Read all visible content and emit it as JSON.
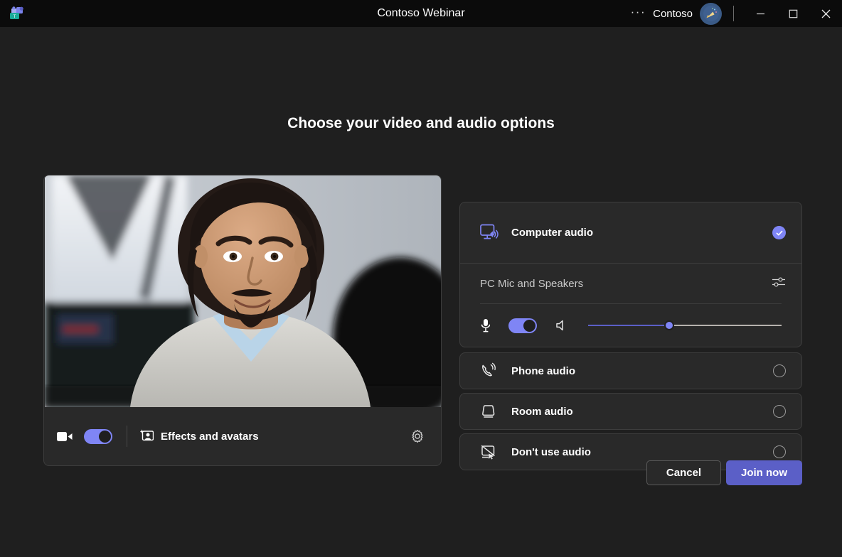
{
  "titlebar": {
    "app_logo": "teams-logo",
    "title": "Contoso Webinar",
    "overflow_label": "···",
    "account_name": "Contoso",
    "avatar_icon": "party-popper-avatar",
    "minimize_label": "Minimize",
    "maximize_label": "Maximize",
    "close_label": "Close"
  },
  "main": {
    "heading": "Choose your video and audio options"
  },
  "video": {
    "camera_icon": "camera-icon",
    "camera_toggle_on": true,
    "effects_icon": "person-sparkle-icon",
    "effects_label": "Effects and avatars",
    "settings_icon": "gear-icon"
  },
  "audio": {
    "computer": {
      "icon": "monitor-speaker-icon",
      "label": "Computer audio",
      "selected": true,
      "check_icon": "checkmark-circle-icon"
    },
    "device": {
      "name": "PC Mic and Speakers",
      "settings_icon": "audio-sliders-icon"
    },
    "mic": {
      "icon": "microphone-icon",
      "toggle_on": true
    },
    "speaker": {
      "icon": "speaker-icon",
      "volume_percent": 42
    },
    "options": [
      {
        "icon": "phone-waves-icon",
        "label": "Phone audio",
        "selected": false
      },
      {
        "icon": "room-device-icon",
        "label": "Room audio",
        "selected": false
      },
      {
        "icon": "monitor-slash-icon",
        "label": "Don't use audio",
        "selected": false
      }
    ]
  },
  "footer": {
    "cancel_label": "Cancel",
    "join_label": "Join now"
  },
  "colors": {
    "accent": "#5b5fc7",
    "accent_light": "#7f85f5",
    "page_bg": "#1f1f1f",
    "panel_bg": "#292929",
    "panel_border": "#3d3d3d"
  }
}
